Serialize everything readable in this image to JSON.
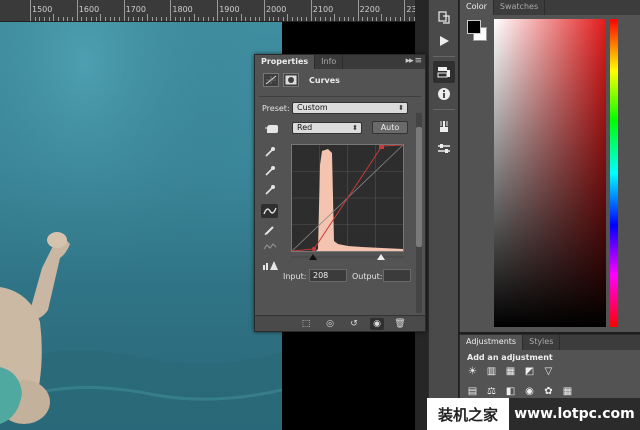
{
  "ruler": {
    "labels": [
      "1500",
      "1600",
      "1700",
      "1800",
      "1900",
      "2000",
      "2100",
      "2200",
      "2300"
    ]
  },
  "properties": {
    "tabs": [
      "Properties",
      "Info"
    ],
    "adjustment_name": "Curves",
    "preset_label": "Preset:",
    "preset_value": "Custom",
    "channel_value": "Red",
    "auto_label": "Auto",
    "input_label": "Input:",
    "input_value": "208",
    "output_label": "Output:",
    "output_value": ""
  },
  "color_panel": {
    "tabs": [
      "Color",
      "Swatches"
    ],
    "foreground": "#000000",
    "background": "#ffffff"
  },
  "adjustments": {
    "tabs": [
      "Adjustments",
      "Styles"
    ],
    "title": "Add an adjustment"
  },
  "watermark": {
    "logo": "装机之家",
    "url": "www.lotpc.com"
  },
  "colors": {
    "panel": "#535353",
    "accent_curve": "#c73a3a",
    "histogram": "#f5c4b0"
  },
  "icons": {
    "toolbar": [
      "history-icon",
      "play-icon",
      "layer-comps-icon",
      "info-icon",
      "brush-icon",
      "tool-presets-icon"
    ],
    "curves_tools": [
      "hand-target-icon",
      "black-eyedropper-icon",
      "gray-eyedropper-icon",
      "white-eyedropper-icon",
      "curve-point-icon",
      "pencil-icon",
      "smooth-icon",
      "clipping-warning-icon"
    ]
  }
}
